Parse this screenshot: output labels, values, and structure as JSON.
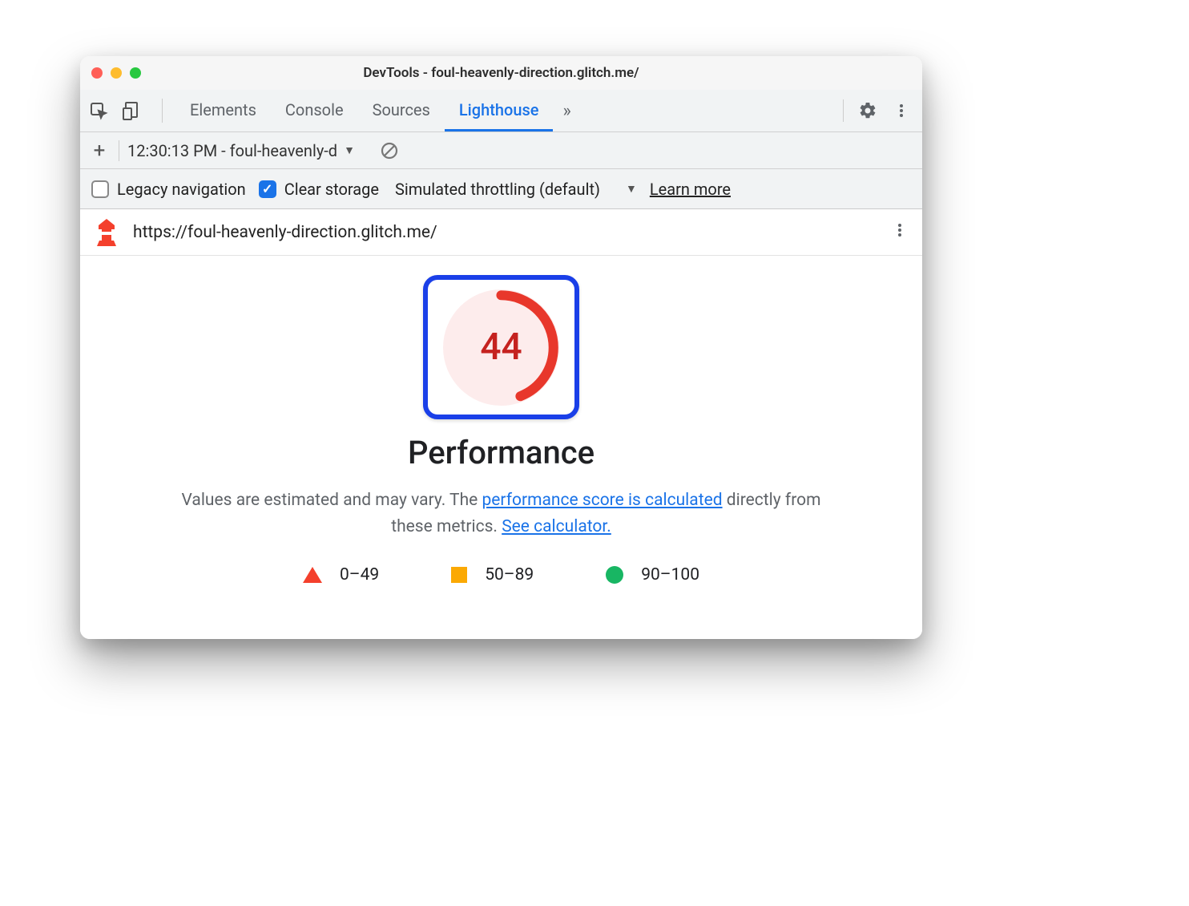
{
  "window": {
    "title": "DevTools - foul-heavenly-direction.glitch.me/"
  },
  "tabs": {
    "items": [
      "Elements",
      "Console",
      "Sources",
      "Lighthouse"
    ],
    "active": "Lighthouse"
  },
  "subbar1": {
    "report_label": "12:30:13 PM - foul-heavenly-d"
  },
  "subbar2": {
    "legacy_label": "Legacy navigation",
    "legacy_checked": false,
    "clear_label": "Clear storage",
    "clear_checked": true,
    "throttling_label": "Simulated throttling (default)",
    "learn_more": "Learn more"
  },
  "urlrow": {
    "url": "https://foul-heavenly-direction.glitch.me/"
  },
  "report": {
    "score": "44",
    "score_pct": 44,
    "title": "Performance",
    "desc_pre": "Values are estimated and may vary. The ",
    "link1": "performance score is calculated",
    "desc_mid": " directly from these metrics. ",
    "link2": "See calculator.",
    "legend": {
      "a": "0–49",
      "b": "50–89",
      "c": "90–100"
    }
  },
  "colors": {
    "fail": "#f4402c",
    "avg": "#fba904",
    "pass": "#18b663",
    "accent": "#1a73e8",
    "highlight_box": "#1a3fe8"
  }
}
